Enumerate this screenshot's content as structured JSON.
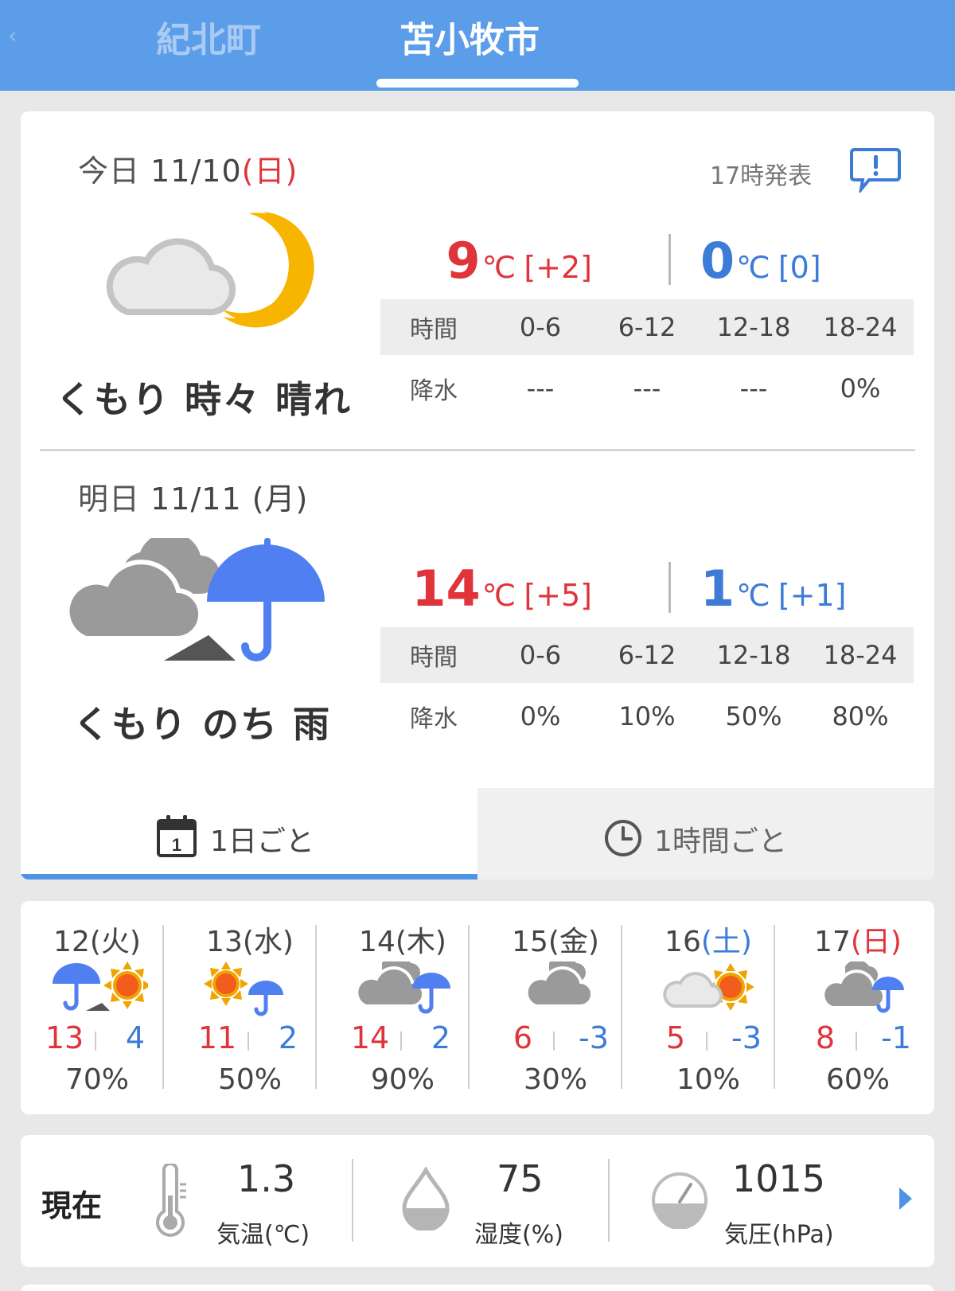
{
  "header": {
    "tabs": [
      {
        "label": "紀北町",
        "active": false
      },
      {
        "label": "苫小牧市",
        "active": true
      }
    ]
  },
  "today": {
    "label": "今日",
    "date": "11/10",
    "weekday": "(日)",
    "issued": "17時発表",
    "condition": "くもり 時々 晴れ",
    "icon": "cloud-moon-icon",
    "high": "9",
    "high_diff": "[+2]",
    "low": "0",
    "low_diff": "[0]",
    "unit": "℃",
    "time_label": "時間",
    "precip_label": "降水",
    "periods": [
      "0-6",
      "6-12",
      "12-18",
      "18-24"
    ],
    "precip": [
      "---",
      "---",
      "---",
      "0%"
    ]
  },
  "tomorrow": {
    "label": "明日",
    "date": "11/11",
    "weekday": "(月)",
    "condition": "くもり のち 雨",
    "icon": "cloud-then-rain-icon",
    "high": "14",
    "high_diff": "[+5]",
    "low": "1",
    "low_diff": "[+1]",
    "unit": "℃",
    "time_label": "時間",
    "precip_label": "降水",
    "periods": [
      "0-6",
      "6-12",
      "12-18",
      "18-24"
    ],
    "precip": [
      "0%",
      "10%",
      "50%",
      "80%"
    ]
  },
  "view_tabs": {
    "daily": "1日ごと",
    "calendar_day": "1",
    "hourly": "1時間ごと"
  },
  "weekly": [
    {
      "day": "12",
      "weekday": "(火)",
      "type": "weekday",
      "icon": "rain-then-sun-icon",
      "high": "13",
      "low": "4",
      "pop": "70%"
    },
    {
      "day": "13",
      "weekday": "(水)",
      "type": "weekday",
      "icon": "sun-with-rain-icon",
      "high": "11",
      "low": "2",
      "pop": "50%"
    },
    {
      "day": "14",
      "weekday": "(木)",
      "type": "weekday",
      "icon": "cloud-with-rain-icon",
      "high": "14",
      "low": "2",
      "pop": "90%"
    },
    {
      "day": "15",
      "weekday": "(金)",
      "type": "weekday",
      "icon": "cloud-icon",
      "high": "6",
      "low": "-3",
      "pop": "30%"
    },
    {
      "day": "16",
      "weekday": "(土)",
      "type": "sat",
      "icon": "cloud-with-sun-icon",
      "high": "5",
      "low": "-3",
      "pop": "10%"
    },
    {
      "day": "17",
      "weekday": "(日)",
      "type": "sun",
      "icon": "cloud-with-rain-icon",
      "high": "8",
      "low": "-1",
      "pop": "60%"
    }
  ],
  "current": {
    "label": "現在",
    "temp": "1.3",
    "temp_label": "気温(℃)",
    "humidity": "75",
    "humidity_label": "湿度(%)",
    "pressure": "1015",
    "pressure_label": "気圧(hPa)"
  },
  "colors": {
    "header": "#5b9de9",
    "high": "#e0343b",
    "low": "#3c7bd6",
    "sun": "#f7b500",
    "umbrella": "#4f7ff0"
  }
}
